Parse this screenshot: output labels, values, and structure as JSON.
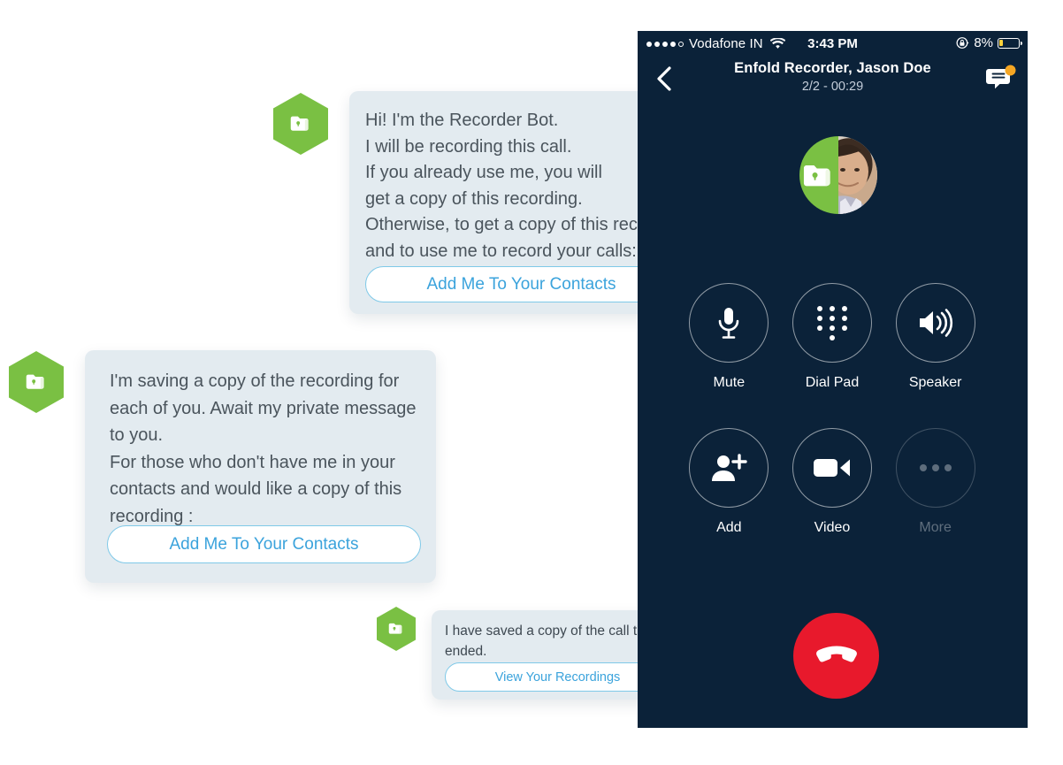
{
  "phone": {
    "status_bar": {
      "carrier": "Vodafone IN",
      "signal_dots_filled": 4,
      "signal_dots_total": 5,
      "wifi_icon": "wifi-icon",
      "time": "3:43 PM",
      "rotation_lock_icon": "rotation-lock-icon",
      "battery_percent": "8%",
      "battery_level": 8,
      "battery_color": "#FFD23A"
    },
    "nav_bar": {
      "back_icon": "chevron-left-icon",
      "title": "Enfold Recorder, Jason Doe",
      "subtitle": "2/2 - 00:29",
      "chat_icon": "chat-bubble-icon",
      "chat_badge_color": "#F5A623"
    },
    "avatar": {
      "name": "call-avatar",
      "left_half_color": "#7AC043",
      "left_half_icon": "folder-lock-icon",
      "right_half": "contact-photo"
    },
    "controls": [
      {
        "label": "Mute",
        "icon": "microphone-icon",
        "disabled": false
      },
      {
        "label": "Dial Pad",
        "icon": "dialpad-icon",
        "disabled": false
      },
      {
        "label": "Speaker",
        "icon": "speaker-icon",
        "disabled": false
      },
      {
        "label": "Add",
        "icon": "add-person-icon",
        "disabled": false
      },
      {
        "label": "Video",
        "icon": "video-camera-icon",
        "disabled": false
      },
      {
        "label": "More",
        "icon": "ellipsis-icon",
        "disabled": true
      }
    ],
    "end_call": {
      "icon": "hang-up-icon",
      "color": "#E8192C"
    },
    "background_color": "#0B2239"
  },
  "chat": {
    "bot_icon": "folder-lock-hexagon-icon",
    "bot_icon_color": "#7AC043",
    "bubble_color": "#E3EBF0",
    "button_border_color": "#7FC9E8",
    "button_text_color": "#3BA3DC",
    "messages": [
      {
        "text": "Hi! I'm the Recorder Bot.\nI will be recording this call.\nIf you already use me, you will\nget a copy of this recording.\nOtherwise, to get a copy of this recording\nand to use me to record your calls:",
        "button": "Add Me To Your Contacts"
      },
      {
        "text": "I'm saving a copy of the recording for\neach of you. Await my private message\nto you.\nFor those who don't have me in your\ncontacts and would like a copy of this\nrecording :",
        "button": "Add Me To Your Contacts"
      },
      {
        "text": "I have saved a copy of the call that just\nended.",
        "button": "View Your Recordings"
      }
    ]
  }
}
